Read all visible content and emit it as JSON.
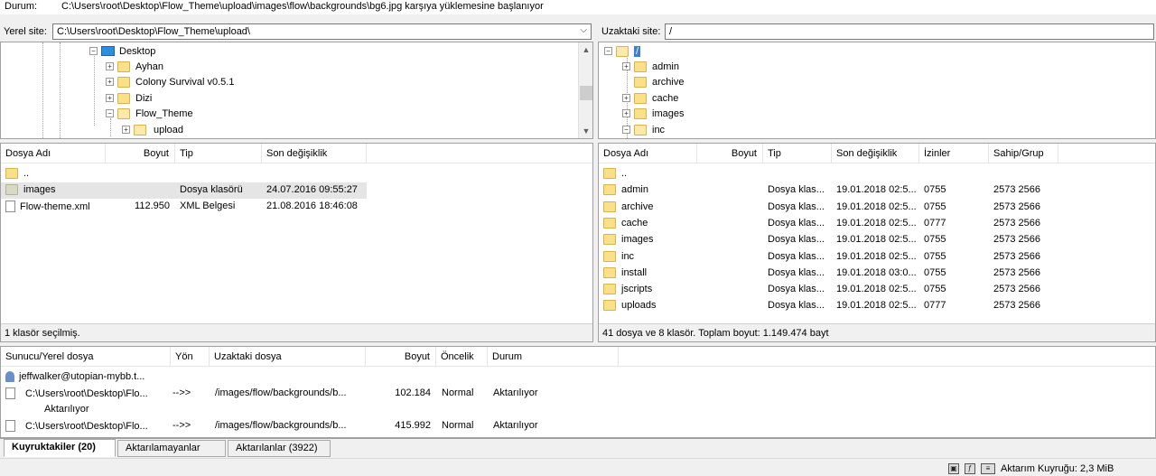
{
  "status": {
    "label": "Durum:",
    "message": "C:\\Users\\root\\Desktop\\Flow_Theme\\upload\\images\\flow\\backgrounds\\bg6.jpg karşıya yüklemesine başlanıyor"
  },
  "local": {
    "site_label": "Yerel site:",
    "site_path": "C:\\Users\\root\\Desktop\\Flow_Theme\\upload\\",
    "tree": [
      {
        "label": "Desktop",
        "expander": "−",
        "icon": "monitor"
      },
      {
        "label": "Ayhan",
        "expander": "+",
        "icon": "folder"
      },
      {
        "label": "Colony Survival v0.5.1",
        "expander": "+",
        "icon": "folder"
      },
      {
        "label": "Dizi",
        "expander": "+",
        "icon": "folder"
      },
      {
        "label": "Flow_Theme",
        "expander": "−",
        "icon": "folder"
      },
      {
        "label": "upload",
        "expander": "+",
        "icon": "folder"
      }
    ],
    "columns": [
      "Dosya Adı",
      "Boyut",
      "Tip",
      "Son değişiklik"
    ],
    "files": [
      {
        "name": "..",
        "size": "",
        "type": "",
        "modified": "",
        "icon": "folder"
      },
      {
        "name": "images",
        "size": "",
        "type": "Dosya klasörü",
        "modified": "24.07.2016 09:55:27",
        "icon": "folder-grey"
      },
      {
        "name": "Flow-theme.xml",
        "size": "112.950",
        "type": "XML Belgesi",
        "modified": "21.08.2016 18:46:08",
        "icon": "file"
      }
    ],
    "status": "1 klasör seçilmiş."
  },
  "remote": {
    "site_label": "Uzaktaki site:",
    "site_path": "/",
    "tree_root": "/",
    "tree": [
      {
        "label": "admin",
        "expander": "+"
      },
      {
        "label": "archive",
        "expander": ""
      },
      {
        "label": "cache",
        "expander": "+"
      },
      {
        "label": "images",
        "expander": "+"
      },
      {
        "label": "inc",
        "expander": "−"
      }
    ],
    "columns": [
      "Dosya Adı",
      "Boyut",
      "Tip",
      "Son değişiklik",
      "İzinler",
      "Sahip/Grup"
    ],
    "files": [
      {
        "name": "..",
        "type": "",
        "modified": "",
        "perms": "",
        "owner": ""
      },
      {
        "name": "admin",
        "type": "Dosya klas...",
        "modified": "19.01.2018 02:5...",
        "perms": "0755",
        "owner": "2573 2566"
      },
      {
        "name": "archive",
        "type": "Dosya klas...",
        "modified": "19.01.2018 02:5...",
        "perms": "0755",
        "owner": "2573 2566"
      },
      {
        "name": "cache",
        "type": "Dosya klas...",
        "modified": "19.01.2018 02:5...",
        "perms": "0777",
        "owner": "2573 2566"
      },
      {
        "name": "images",
        "type": "Dosya klas...",
        "modified": "19.01.2018 02:5...",
        "perms": "0755",
        "owner": "2573 2566"
      },
      {
        "name": "inc",
        "type": "Dosya klas...",
        "modified": "19.01.2018 02:5...",
        "perms": "0755",
        "owner": "2573 2566"
      },
      {
        "name": "install",
        "type": "Dosya klas...",
        "modified": "19.01.2018 03:0...",
        "perms": "0755",
        "owner": "2573 2566"
      },
      {
        "name": "jscripts",
        "type": "Dosya klas...",
        "modified": "19.01.2018 02:5...",
        "perms": "0755",
        "owner": "2573 2566"
      },
      {
        "name": "uploads",
        "type": "Dosya klas...",
        "modified": "19.01.2018 02:5...",
        "perms": "0777",
        "owner": "2573 2566"
      }
    ],
    "status": "41 dosya ve 8 klasör. Toplam boyut: 1.149.474 bayt"
  },
  "queue": {
    "columns": [
      "Sunucu/Yerel dosya",
      "Yön",
      "Uzaktaki dosya",
      "Boyut",
      "Öncelik",
      "Durum"
    ],
    "server": "jeffwalker@utopian-mybb.t...",
    "items": [
      {
        "local": "C:\\Users\\root\\Desktop\\Flo...",
        "direction": "-->>",
        "remote": "/images/flow/backgrounds/b...",
        "size": "102.184",
        "priority": "Normal",
        "status": "Aktarılıyor",
        "sub": "Aktarılıyor"
      },
      {
        "local": "C:\\Users\\root\\Desktop\\Flo...",
        "direction": "-->>",
        "remote": "/images/flow/backgrounds/b...",
        "size": "415.992",
        "priority": "Normal",
        "status": "Aktarılıyor",
        "sub": ""
      }
    ]
  },
  "tabs": [
    "Kuyruktakiler (20)",
    "Aktarılamayanlar",
    "Aktarılanlar (3922)"
  ],
  "bottom": {
    "queue_text": "Aktarım Kuyruğu: 2,3 MiB"
  }
}
